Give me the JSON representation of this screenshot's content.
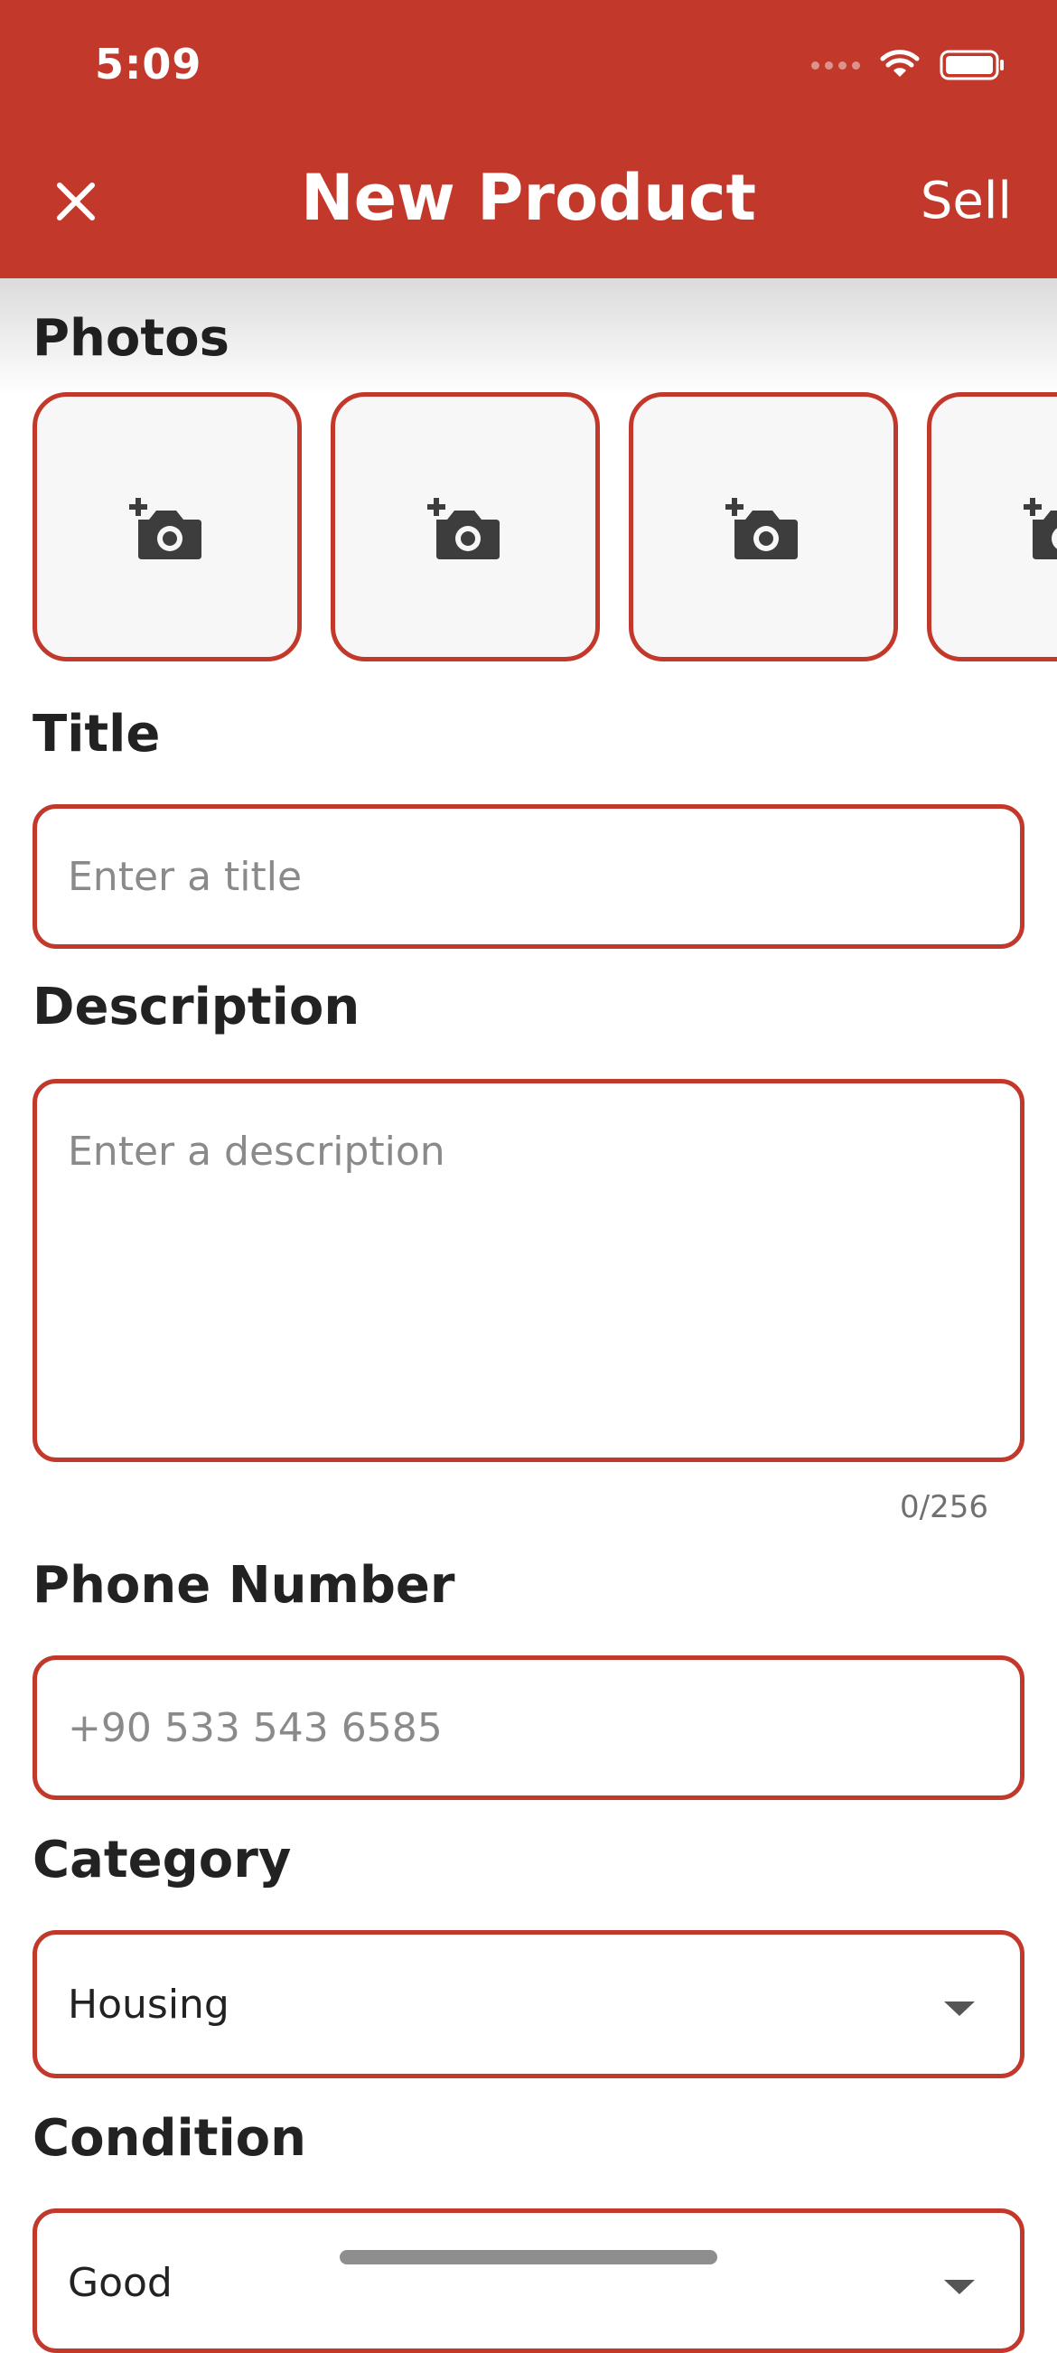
{
  "status_bar": {
    "time": "5:09"
  },
  "nav": {
    "title": "New Product",
    "action_label": "Sell",
    "close_icon": "close-icon"
  },
  "photos": {
    "label": "Photos",
    "slot_icon": "add-photo-icon",
    "slot_count_visible": 4
  },
  "title_field": {
    "label": "Title",
    "placeholder": "Enter a title"
  },
  "description_field": {
    "label": "Description",
    "placeholder": "Enter a description",
    "counter": "0/256"
  },
  "phone_field": {
    "label": "Phone Number",
    "placeholder": "+90 533 543 6585"
  },
  "category_field": {
    "label": "Category",
    "value": "Housing"
  },
  "condition_field": {
    "label": "Condition",
    "value": "Good"
  },
  "colors": {
    "accent": "#c2392c"
  }
}
